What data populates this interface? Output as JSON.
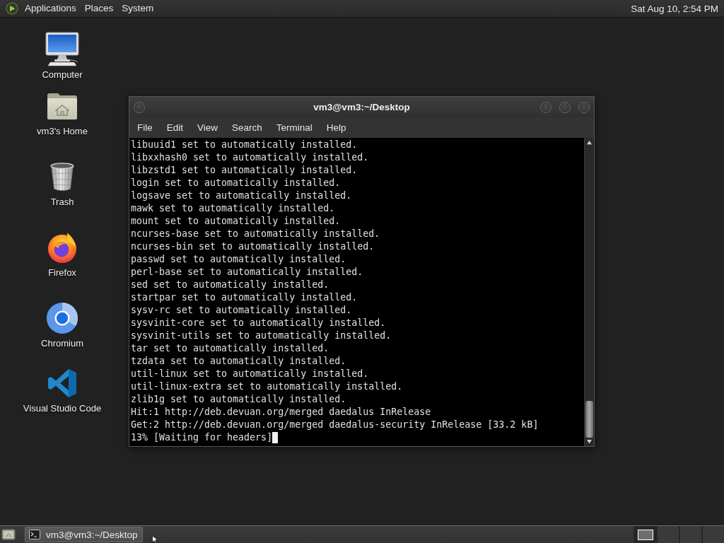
{
  "top_panel": {
    "menus": [
      "Applications",
      "Places",
      "System"
    ],
    "clock": "Sat Aug 10, 2:54 PM"
  },
  "desktop_icons": [
    {
      "kind": "computer",
      "label": "Computer"
    },
    {
      "kind": "home",
      "label": "vm3's Home"
    },
    {
      "kind": "trash",
      "label": "Trash"
    },
    {
      "kind": "firefox",
      "label": "Firefox"
    },
    {
      "kind": "chromium",
      "label": "Chromium"
    },
    {
      "kind": "vscode",
      "label": "Visual Studio Code"
    }
  ],
  "terminal_window": {
    "title": "vm3@vm3:~/Desktop",
    "menu": [
      "File",
      "Edit",
      "View",
      "Search",
      "Terminal",
      "Help"
    ],
    "lines": [
      "libuuid1 set to automatically installed.",
      "libxxhash0 set to automatically installed.",
      "libzstd1 set to automatically installed.",
      "login set to automatically installed.",
      "logsave set to automatically installed.",
      "mawk set to automatically installed.",
      "mount set to automatically installed.",
      "ncurses-base set to automatically installed.",
      "ncurses-bin set to automatically installed.",
      "passwd set to automatically installed.",
      "perl-base set to automatically installed.",
      "sed set to automatically installed.",
      "startpar set to automatically installed.",
      "sysv-rc set to automatically installed.",
      "sysvinit-core set to automatically installed.",
      "sysvinit-utils set to automatically installed.",
      "tar set to automatically installed.",
      "tzdata set to automatically installed.",
      "util-linux set to automatically installed.",
      "util-linux-extra set to automatically installed.",
      "zlib1g set to automatically installed.",
      "Hit:1 http://deb.devuan.org/merged daedalus InRelease",
      "Get:2 http://deb.devuan.org/merged daedalus-security InRelease [33.2 kB]",
      "13% [Waiting for headers]"
    ],
    "cursor": true
  },
  "bottom_panel": {
    "tasks": [
      {
        "label": "vm3@vm3:~/Desktop",
        "active": true
      }
    ],
    "workspaces": [
      {
        "selected": true,
        "has_window": true
      },
      {
        "selected": false,
        "has_window": false
      },
      {
        "selected": false,
        "has_window": false
      },
      {
        "selected": false,
        "has_window": false
      }
    ]
  }
}
